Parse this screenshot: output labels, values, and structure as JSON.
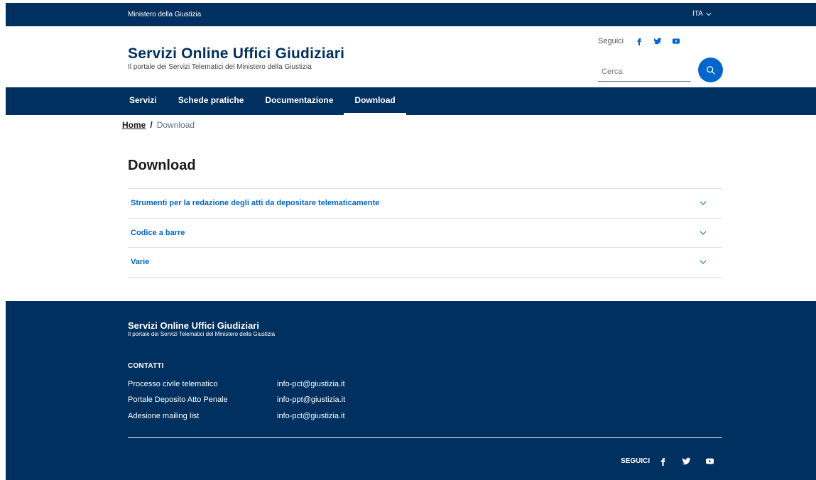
{
  "slim_header": {
    "ministry": "Ministero della Giustizia",
    "language": "ITA"
  },
  "header": {
    "title": "Servizi Online Uffici Giudiziari",
    "subtitle": "Il portale dei Servizi Telematici del Ministero della Giustizia",
    "follow_label": "Seguici",
    "search_placeholder": "Cerca",
    "social_icons": [
      "facebook-icon",
      "twitter-icon",
      "youtube-icon"
    ]
  },
  "nav": {
    "items": [
      {
        "label": "Servizi",
        "active": false
      },
      {
        "label": "Schede pratiche",
        "active": false
      },
      {
        "label": "Documentazione",
        "active": false
      },
      {
        "label": "Download",
        "active": true
      }
    ]
  },
  "breadcrumb": {
    "home": "Home",
    "separator": "/",
    "current": "Download"
  },
  "main": {
    "title": "Download",
    "accordion": [
      {
        "label": "Strumenti per la redazione degli atti da depositare telematicamente"
      },
      {
        "label": "Codice a barre"
      },
      {
        "label": "Varie"
      }
    ]
  },
  "footer": {
    "title": "Servizi Online Uffici Giudiziari",
    "subtitle": "Il portale dei Servizi Telematici del Ministero della Giustizia",
    "contacts_heading": "CONTATTI",
    "contacts": [
      {
        "name": "Processo civile telematico",
        "email": "info-pct@giustizia.it"
      },
      {
        "name": "Portale Deposito Atto Penale",
        "email": "info-ppt@giustizia.it"
      },
      {
        "name": "Adesione mailing list",
        "email": "info-pct@giustizia.it"
      }
    ],
    "follow_label": "SEGUICI"
  },
  "colors": {
    "primary_dark": "#00305f",
    "accent_blue": "#0066cc",
    "divider": "#e0e4e8"
  }
}
